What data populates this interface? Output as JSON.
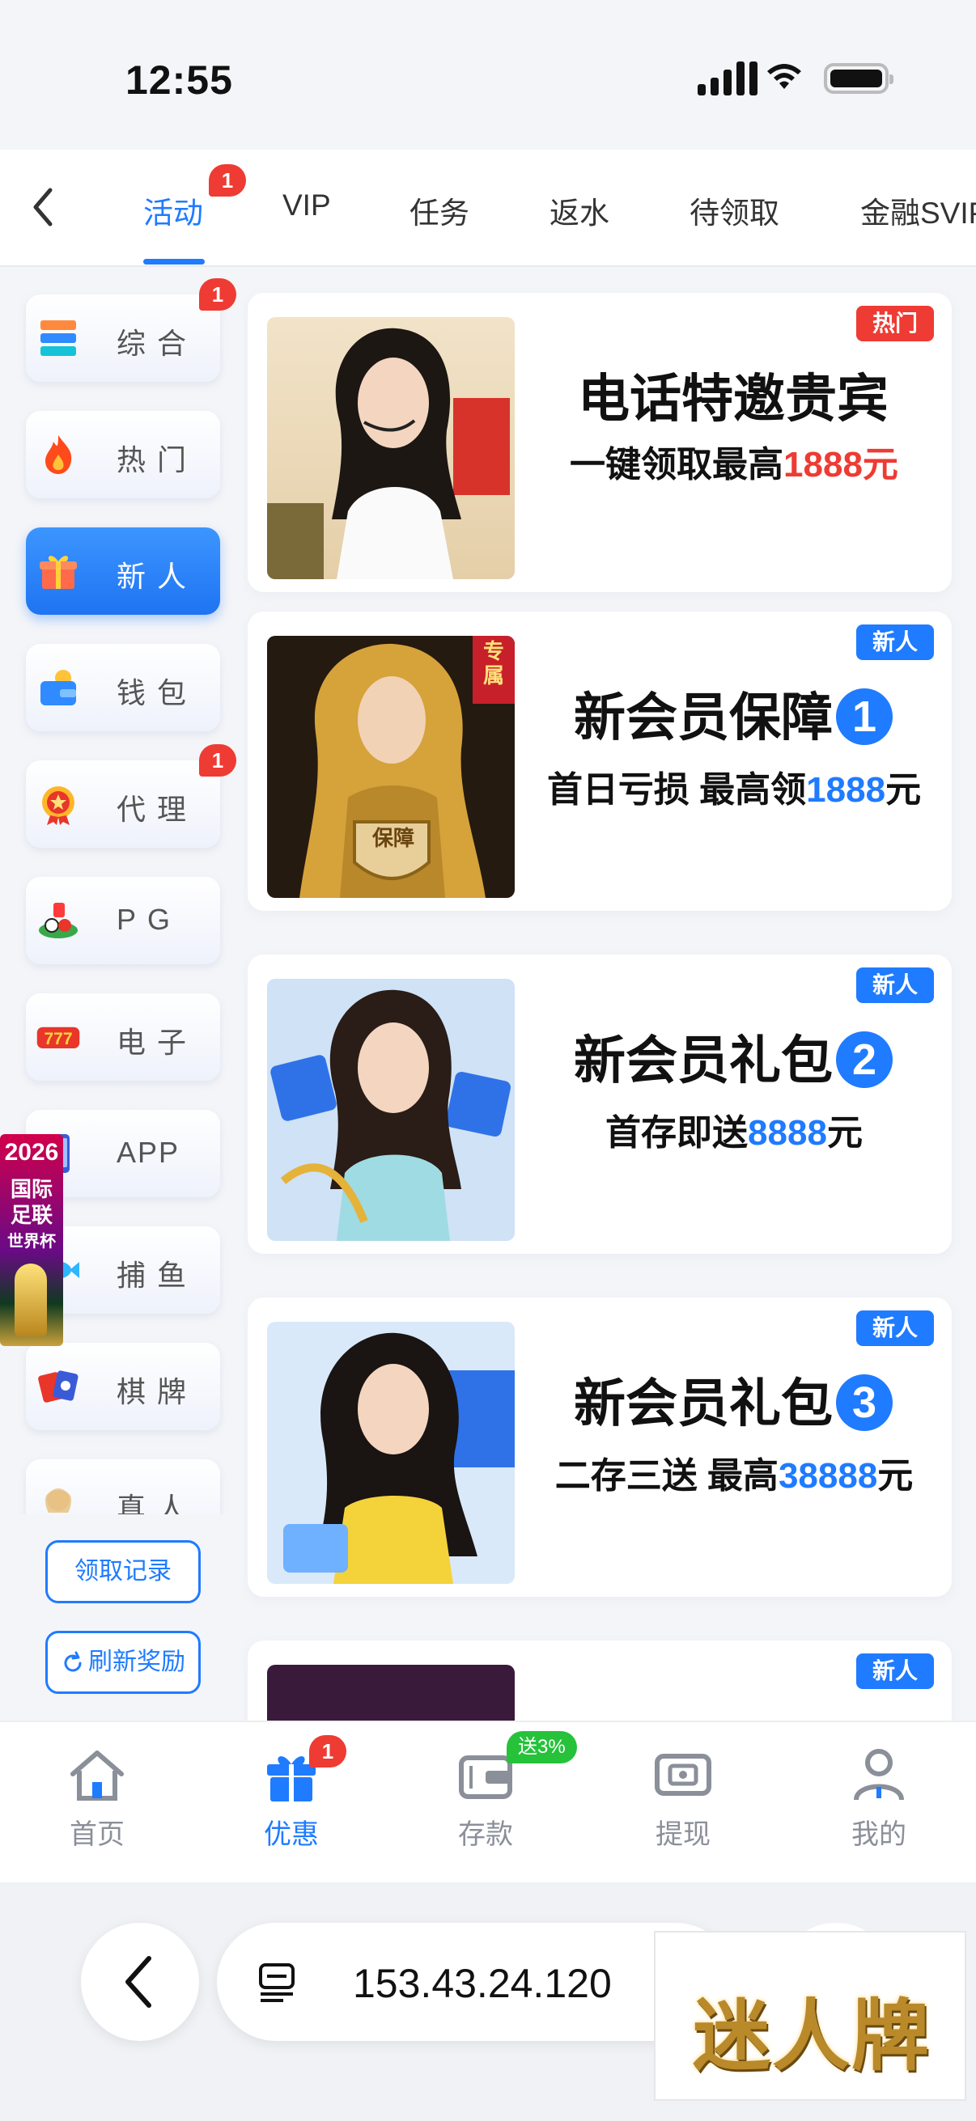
{
  "status_bar": {
    "time": "12:55"
  },
  "tabs": [
    {
      "label": "活动",
      "badge": "1",
      "active": true
    },
    {
      "label": "VIP"
    },
    {
      "label": "任务"
    },
    {
      "label": "返水"
    },
    {
      "label": "待领取"
    },
    {
      "label": "金融SVIP"
    }
  ],
  "sidebar": {
    "categories": [
      {
        "label": "综合",
        "badge": "1",
        "icon": "layers-icon"
      },
      {
        "label": "热门",
        "icon": "flame-icon"
      },
      {
        "label": "新人",
        "icon": "gift-icon",
        "active": true
      },
      {
        "label": "钱包",
        "icon": "wallet-icon"
      },
      {
        "label": "代理",
        "badge": "1",
        "icon": "medal-icon"
      },
      {
        "label": "PG",
        "icon": "pg-icon"
      },
      {
        "label": "电子",
        "icon": "slot-777-icon"
      },
      {
        "label": "APP",
        "icon": "phone-icon"
      },
      {
        "label": "捕鱼",
        "icon": "fish-icon"
      },
      {
        "label": "棋牌",
        "icon": "cards-icon"
      },
      {
        "label": "真人",
        "icon": "live-dealer-icon"
      }
    ],
    "claim_record": "领取记录",
    "refresh_rewards": "刷新奖励"
  },
  "world_cup": {
    "year": "2026",
    "line1": "国际",
    "line2": "足联",
    "line3": "世界杯"
  },
  "promos": [
    {
      "tag": "热门",
      "tag_type": "hot",
      "title": "电话特邀贵宾",
      "sub_prefix": "一键领取最高",
      "amount": "1888元",
      "amount_color": "red",
      "image": "woman-headset-photo"
    },
    {
      "tag": "新人",
      "tag_type": "new",
      "title": "新会员保障",
      "number": "1",
      "sub_prefix": "首日亏损 最高领",
      "amount": "1888",
      "sub_suffix": "元",
      "amount_color": "blue",
      "image": "woman-gold-shield-photo",
      "image_tag": "专属",
      "image_badge": "保障"
    },
    {
      "tag": "新人",
      "tag_type": "new",
      "title": "新会员礼包",
      "number": "2",
      "sub_prefix": "首存即送",
      "amount": "8888",
      "sub_suffix": "元",
      "amount_color": "blue",
      "image": "woman-gift-photo"
    },
    {
      "tag": "新人",
      "tag_type": "new",
      "title": "新会员礼包",
      "number": "3",
      "sub_prefix": "二存三送 最高",
      "amount": "38888",
      "sub_suffix": "元",
      "amount_color": "blue",
      "image": "woman-yellow-dress-photo"
    },
    {
      "tag": "新人",
      "tag_type": "new"
    }
  ],
  "bottom_nav": [
    {
      "label": "首页",
      "icon": "home-icon"
    },
    {
      "label": "优惠",
      "icon": "gift-icon",
      "badge": "1",
      "active": true
    },
    {
      "label": "存款",
      "icon": "deposit-wallet-icon",
      "badge": "送3%"
    },
    {
      "label": "提现",
      "icon": "withdraw-icon"
    },
    {
      "label": "我的",
      "icon": "profile-icon"
    }
  ],
  "browser": {
    "url": "153.43.24.120"
  },
  "brand": {
    "text": "迷人牌"
  },
  "colors": {
    "accent": "#1f7bff",
    "hot": "#ee3b33",
    "green": "#25c23a"
  }
}
